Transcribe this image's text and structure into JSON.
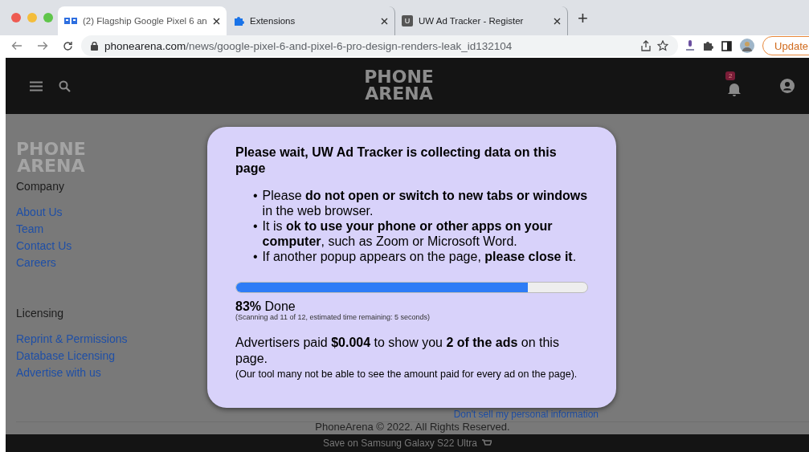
{
  "browser": {
    "tabs": [
      {
        "title": "(2) Flagship Google Pixel 6 an",
        "selected": true
      },
      {
        "title": "Extensions",
        "selected": false
      },
      {
        "title": "UW Ad Tracker - Register",
        "selected": false,
        "icon_text": "U"
      }
    ],
    "new_tab": "+",
    "url": {
      "host": "phonearena.com",
      "path": "/news/google-pixel-6-and-pixel-6-pro-design-renders-leak_id132104"
    },
    "update_button": "Update"
  },
  "site": {
    "logo": [
      "PHONE",
      "ARENA"
    ],
    "notification_count": "2",
    "footer": {
      "logo": [
        "PHONE",
        "ARENA"
      ],
      "sections": [
        {
          "heading": "Company",
          "links": [
            "About Us",
            "Team",
            "Contact Us",
            "Careers"
          ]
        },
        {
          "heading": "Licensing",
          "links": [
            "Reprint & Permissions",
            "Database Licensing",
            "Advertise with us"
          ]
        }
      ],
      "privacy_link": "Don't sell my personal information",
      "copyright": "PhoneArena © 2022. All Rights Reserved."
    },
    "promo_bar": "Save on Samsung Galaxy S22 Ultra"
  },
  "popup": {
    "bullet_marker": "•",
    "title": "Please wait, UW Ad Tracker is collecting data on this page",
    "bullets": [
      "Please **do not open or switch to new tabs or windows** in the web browser.",
      "It is **ok to use your phone or other apps on your computer**, such as Zoom or Microsoft Word.",
      "If another popup appears on the page, **please close it**."
    ],
    "progress": {
      "level": 0.83,
      "percent": "83%",
      "label": "Done",
      "detail": "(Scanning ad 11 of 12, estimated time remaining: 5 seconds)"
    },
    "summary": "Advertisers paid **$0.004** to show you **2 of the ads** on this page.",
    "note": "(Our tool many not be able to see the amount paid for every ad on the page)."
  }
}
